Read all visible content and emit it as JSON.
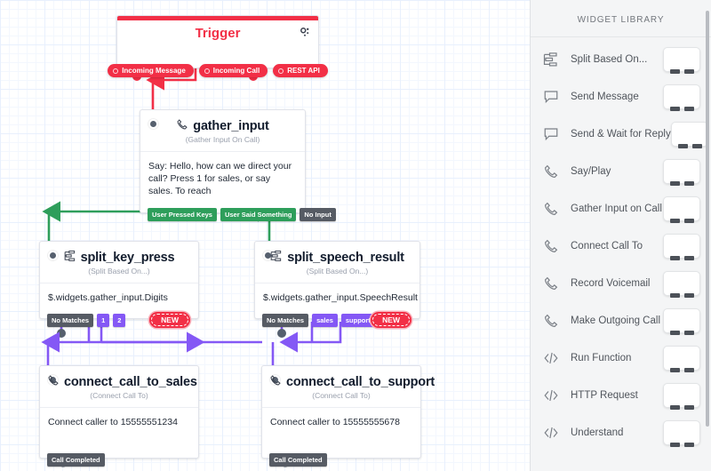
{
  "canvas": {
    "trigger": {
      "title": "Trigger",
      "gear_icon": "gear-icon",
      "pills": [
        {
          "label": "Incoming Message",
          "name": "trigger-incoming-message"
        },
        {
          "label": "Incoming Call",
          "name": "trigger-incoming-call"
        },
        {
          "label": "REST API",
          "name": "trigger-rest-api"
        }
      ]
    },
    "nodes": [
      {
        "id": "gather_input",
        "title": "gather_input",
        "subtitle": "(Gather Input On Call)",
        "icon": "phone-icon",
        "body": "Say: Hello, how can we direct your call? Press 1 for sales, or say sales. To reach",
        "chips": [
          {
            "label": "User Pressed Keys",
            "color": "green"
          },
          {
            "label": "User Said Something",
            "color": "green"
          },
          {
            "label": "No Input",
            "color": "grey"
          }
        ],
        "badge": null
      },
      {
        "id": "split_key_press",
        "title": "split_key_press",
        "subtitle": "(Split Based On...)",
        "icon": "split-icon",
        "body": "$.widgets.gather_input.Digits",
        "chips": [
          {
            "label": "No Matches",
            "color": "grey"
          },
          {
            "label": "1",
            "color": "purple"
          },
          {
            "label": "2",
            "color": "purple"
          }
        ],
        "badge": "NEW"
      },
      {
        "id": "split_speech_result",
        "title": "split_speech_result",
        "subtitle": "(Split Based On...)",
        "icon": "split-icon",
        "body": "$.widgets.gather_input.SpeechResult",
        "chips": [
          {
            "label": "No Matches",
            "color": "grey"
          },
          {
            "label": "sales",
            "color": "purple"
          },
          {
            "label": "support",
            "color": "purple"
          }
        ],
        "badge": "NEW"
      },
      {
        "id": "connect_call_to_sales",
        "title": "connect_call_to_sales",
        "subtitle": "(Connect Call To)",
        "icon": "phone-icon",
        "body": "Connect caller to 15555551234",
        "chips": [
          {
            "label": "Call Completed",
            "color": "grey"
          }
        ],
        "badge": null
      },
      {
        "id": "connect_call_to_support",
        "title": "connect_call_to_support",
        "subtitle": "(Connect Call To)",
        "icon": "phone-icon",
        "body": "Connect caller to 15555555678",
        "chips": [
          {
            "label": "Call Completed",
            "color": "grey"
          }
        ],
        "badge": null
      }
    ],
    "colors": {
      "trigger_red": "#f22f46",
      "green_edge": "#2e9e5b",
      "purple_edge": "#8458f5",
      "grey_chip": "#565b64"
    }
  },
  "library": {
    "title": "WIDGET LIBRARY",
    "items": [
      {
        "label": "Split Based On...",
        "icon": "split-icon"
      },
      {
        "label": "Send Message",
        "icon": "chat-bubble-icon"
      },
      {
        "label": "Send & Wait for Reply",
        "icon": "chat-bubble-icon"
      },
      {
        "label": "Say/Play",
        "icon": "phone-icon"
      },
      {
        "label": "Gather Input on Call",
        "icon": "phone-icon"
      },
      {
        "label": "Connect Call To",
        "icon": "phone-icon"
      },
      {
        "label": "Record Voicemail",
        "icon": "phone-icon"
      },
      {
        "label": "Make Outgoing Call",
        "icon": "phone-icon"
      },
      {
        "label": "Run Function",
        "icon": "code-icon"
      },
      {
        "label": "HTTP Request",
        "icon": "code-icon"
      },
      {
        "label": "Understand",
        "icon": "code-icon"
      }
    ]
  }
}
